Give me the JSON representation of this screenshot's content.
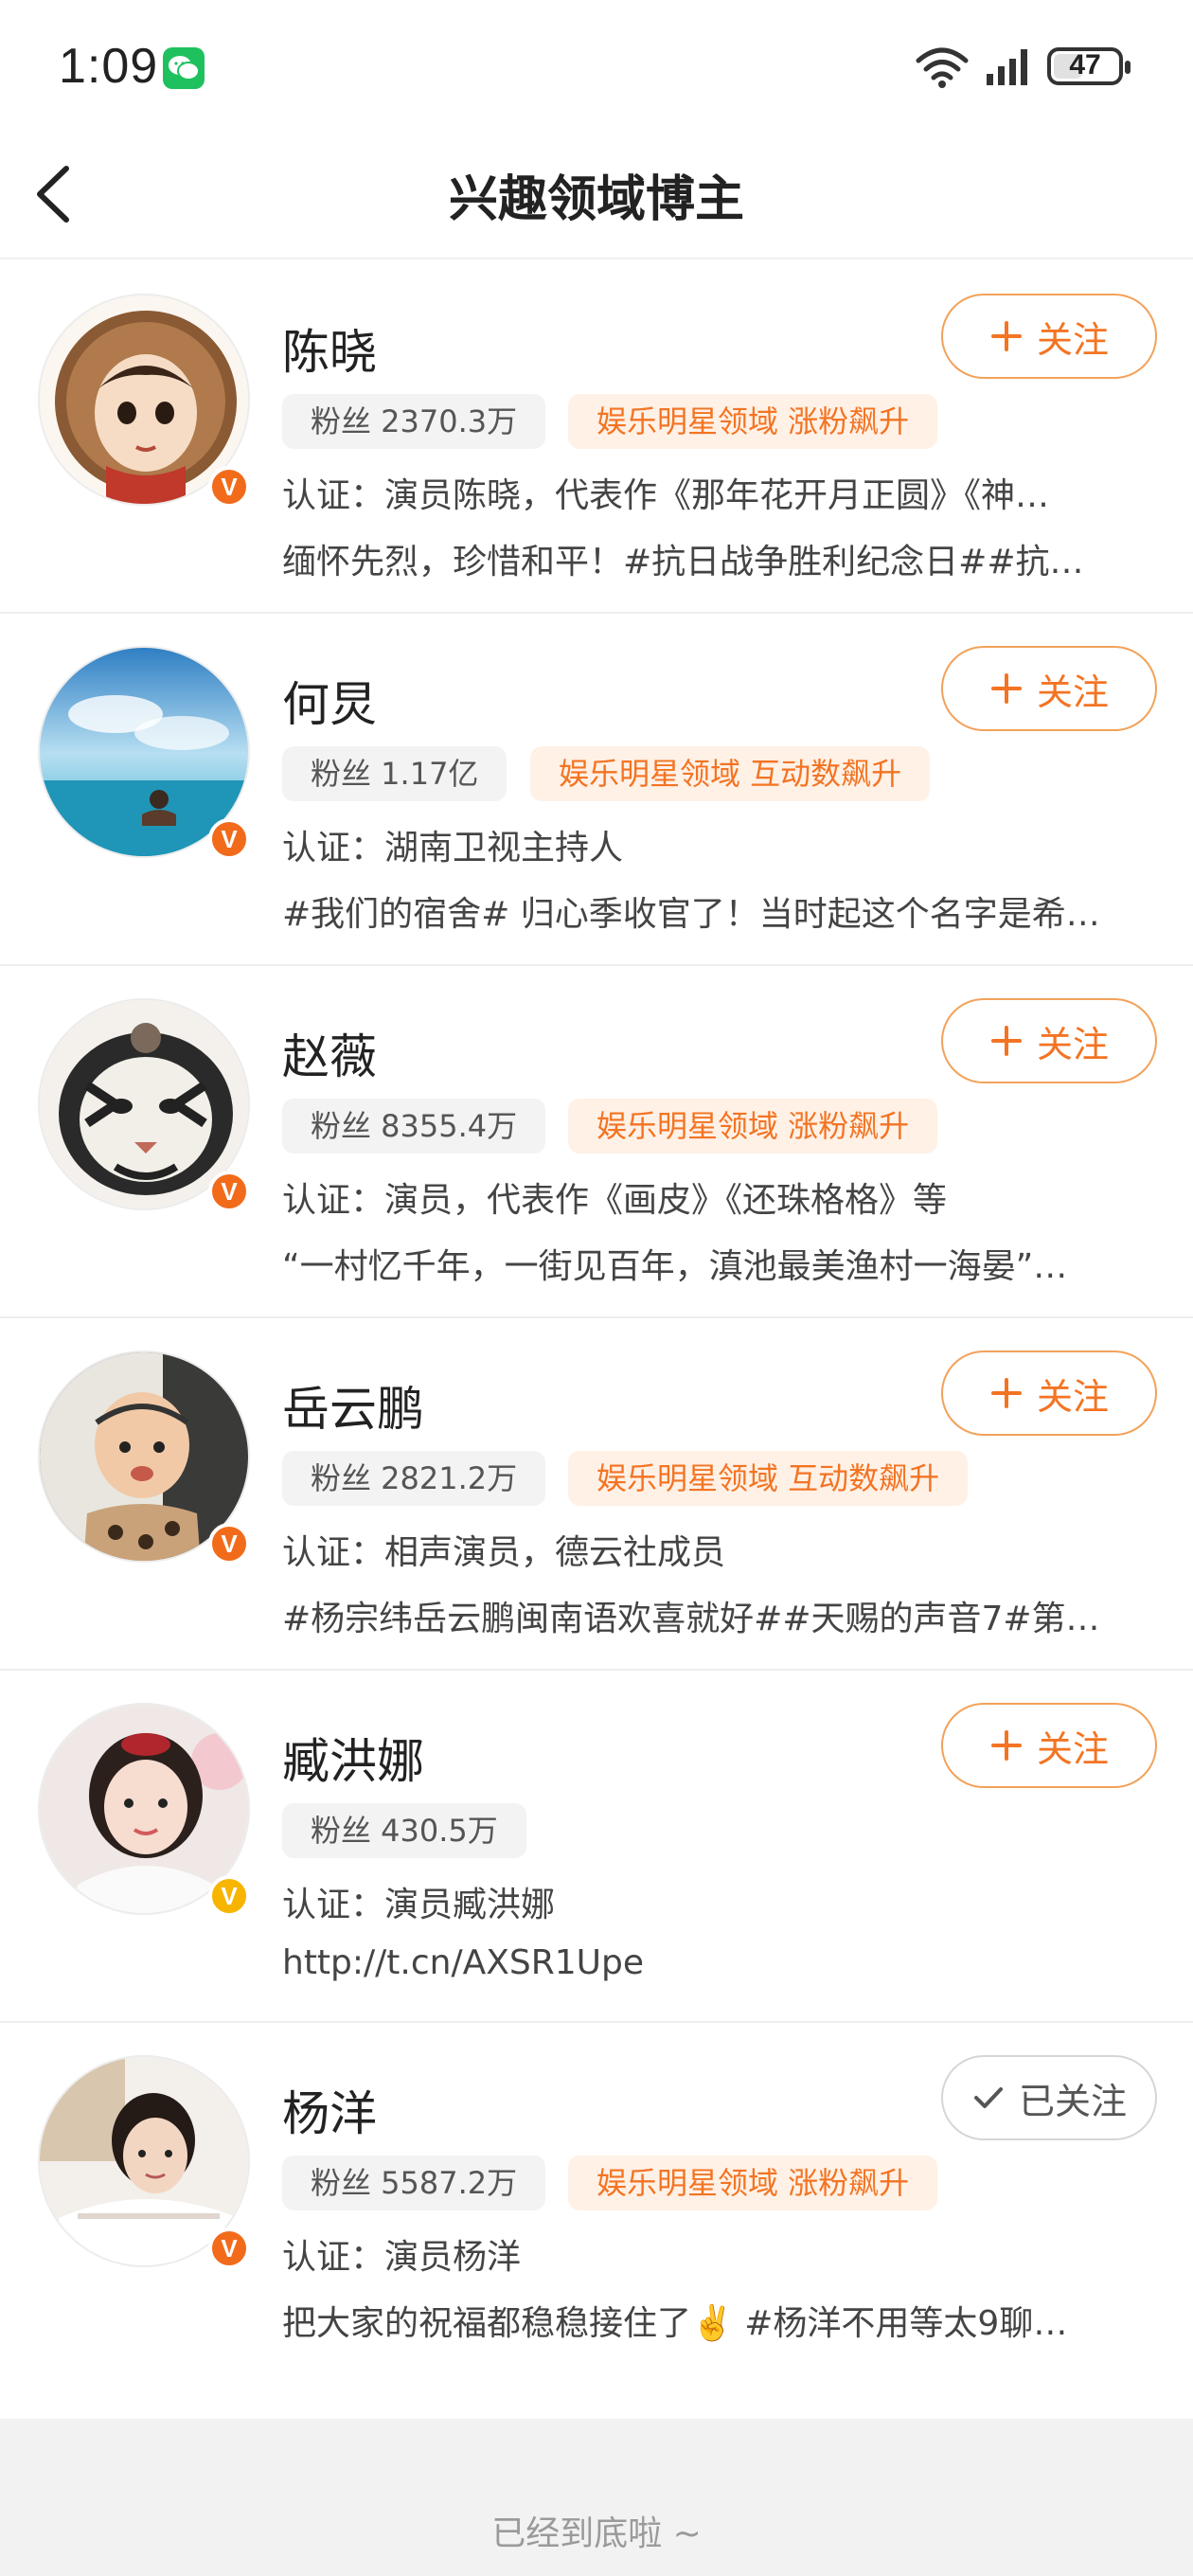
{
  "status_bar": {
    "time": "1:09",
    "battery": "47",
    "icons": [
      "wechat-icon",
      "wifi-icon",
      "signal-icon",
      "battery-icon"
    ]
  },
  "header": {
    "title": "兴趣领域博主",
    "back_icon": "chevron-left-icon"
  },
  "colors": {
    "accent": "#f37423",
    "badge_orange": "#f26b1a",
    "badge_gold": "#f7b500",
    "tag_bg": "#fff1e6"
  },
  "bloggers": [
    {
      "name": "陈晓",
      "fans": "粉丝 2370.3万",
      "tag": "娱乐明星领域 涨粉飙升",
      "cert": "认证：演员陈晓，代表作《那年花开月正圆》《神…",
      "desc": "缅怀先烈，珍惜和平！#抗日战争胜利纪念日##抗…",
      "button": "关注",
      "followed": false,
      "badge": "V"
    },
    {
      "name": "何炅",
      "fans": "粉丝 1.17亿",
      "tag": "娱乐明星领域 互动数飙升",
      "cert": "认证：湖南卫视主持人",
      "desc": "#我们的宿舍# 归心季收官了！当时起这个名字是希…",
      "button": "关注",
      "followed": false,
      "badge": "V"
    },
    {
      "name": "赵薇",
      "fans": "粉丝 8355.4万",
      "tag": "娱乐明星领域 涨粉飙升",
      "cert": "认证：演员，代表作《画皮》《还珠格格》等",
      "desc": "“一村忆千年，一街见百年，滇池最美渔村一海晏”…",
      "button": "关注",
      "followed": false,
      "badge": "V"
    },
    {
      "name": "岳云鹏",
      "fans": "粉丝 2821.2万",
      "tag": "娱乐明星领域 互动数飙升",
      "cert": "认证：相声演员，德云社成员",
      "desc": "#杨宗纬岳云鹏闽南语欢喜就好##天赐的声音7#第…",
      "button": "关注",
      "followed": false,
      "badge": "V"
    },
    {
      "name": "臧洪娜",
      "fans": "粉丝 430.5万",
      "tag": "",
      "cert": "认证：演员臧洪娜",
      "desc": "http://t.cn/AXSR1Upe",
      "button": "关注",
      "followed": false,
      "badge": "V"
    },
    {
      "name": "杨洋",
      "fans": "粉丝 5587.2万",
      "tag": "娱乐明星领域 涨粉飙升",
      "cert": "认证：演员杨洋",
      "desc": "把大家的祝福都稳稳接住了✌️ #杨洋不用等太9聊…",
      "button": "已关注",
      "followed": true,
      "badge": "V"
    }
  ],
  "footer": {
    "text": "已经到底啦 ~"
  }
}
